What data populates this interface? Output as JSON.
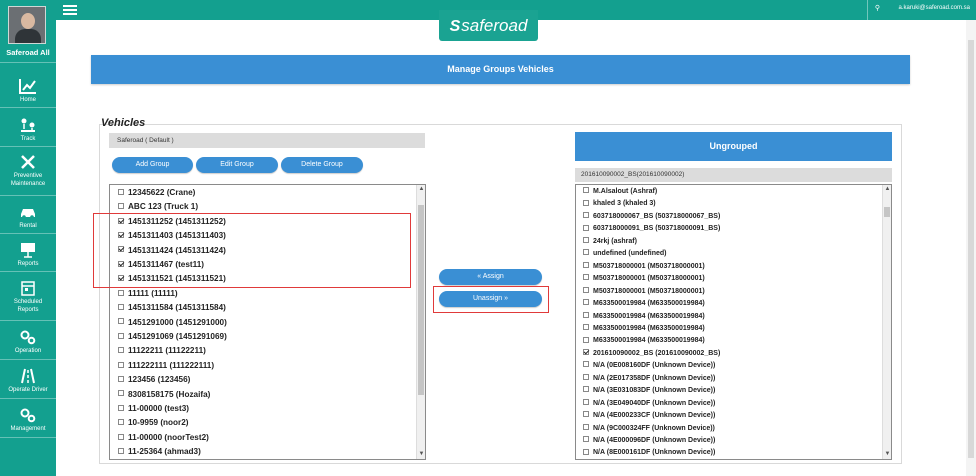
{
  "sidebar": {
    "user_label": "Saferoad All",
    "items": [
      {
        "label": "Home",
        "icon": "chart-icon"
      },
      {
        "label": "Track",
        "icon": "track-icon"
      },
      {
        "label": "Preventive Maintenance",
        "label1": "Preventive",
        "label2": "Maintenance",
        "icon": "tools-icon"
      },
      {
        "label": "Rental",
        "icon": "car-icon"
      },
      {
        "label": "Reports",
        "icon": "presentation-icon"
      },
      {
        "label": "Scheduled Reports",
        "label1": "Scheduled",
        "label2": "Reports",
        "icon": "calendar-icon"
      },
      {
        "label": "Operation",
        "icon": "gears-icon"
      },
      {
        "label": "Operate Driver",
        "icon": "road-icon"
      },
      {
        "label": "Management",
        "icon": "gears-icon"
      }
    ]
  },
  "topbar": {
    "user_email": "a.karuki@saferoad.com.sa"
  },
  "logo": {
    "text": "saferoad"
  },
  "banner": {
    "title": "Manage Groups Vehicles"
  },
  "vehicles": {
    "title": "Vehicles",
    "group_header": "Saferoad ( Default )",
    "buttons": {
      "add": "Add Group",
      "edit": "Edit Group",
      "delete": "Delete Group"
    },
    "items": [
      {
        "text": "12345622 (Crane)",
        "checked": false
      },
      {
        "text": "ABC 123 (Truck 1)",
        "checked": false
      },
      {
        "text": "1451311252 (1451311252)",
        "checked": true
      },
      {
        "text": "1451311403 (1451311403)",
        "checked": true
      },
      {
        "text": "1451311424 (1451311424)",
        "checked": true
      },
      {
        "text": "1451311467 (test11)",
        "checked": true
      },
      {
        "text": "1451311521 (1451311521)",
        "checked": true
      },
      {
        "text": "11111 (11111)",
        "checked": false
      },
      {
        "text": "1451311584 (1451311584)",
        "checked": false
      },
      {
        "text": "1451291000 (1451291000)",
        "checked": false
      },
      {
        "text": "1451291069 (1451291069)",
        "checked": false
      },
      {
        "text": "11122211 (11122211)",
        "checked": false
      },
      {
        "text": "111222111 (111222111)",
        "checked": false
      },
      {
        "text": "123456 (123456)",
        "checked": false
      },
      {
        "text": "8308158175 (Hozaifa)",
        "checked": false
      },
      {
        "text": "11-00000 (test3)",
        "checked": false
      },
      {
        "text": "10-9959 (noor2)",
        "checked": false
      },
      {
        "text": "11-00000 (noorTest2)",
        "checked": false
      },
      {
        "text": "11-25364 (ahmad3)",
        "checked": false
      }
    ]
  },
  "actions": {
    "assign": "« Assign",
    "unassign": "Unassign »"
  },
  "ungrouped": {
    "title": "Ungrouped",
    "sub_header": "201610090002_BS(201610090002)",
    "items": [
      {
        "text": "M.Alsalout (Ashraf)",
        "checked": false
      },
      {
        "text": "khaled 3 (khaled 3)",
        "checked": false
      },
      {
        "text": "603718000067_BS (503718000067_BS)",
        "checked": false
      },
      {
        "text": "603718000091_BS (503718000091_BS)",
        "checked": false
      },
      {
        "text": "24rkj (ashraf)",
        "checked": false
      },
      {
        "text": "undefined (undefined)",
        "checked": false
      },
      {
        "text": "M503718000001 (M503718000001)",
        "checked": false
      },
      {
        "text": "M503718000001 (M503718000001)",
        "checked": false
      },
      {
        "text": "M503718000001 (M503718000001)",
        "checked": false
      },
      {
        "text": "M633500019984 (M633500019984)",
        "checked": false
      },
      {
        "text": "M633500019984 (M633500019984)",
        "checked": false
      },
      {
        "text": "M633500019984 (M633500019984)",
        "checked": false
      },
      {
        "text": "M633500019984 (M633500019984)",
        "checked": false
      },
      {
        "text": "201610090002_BS (201610090002_BS)",
        "checked": true
      },
      {
        "text": "N/A (0E008160DF (Unknown Device))",
        "checked": false
      },
      {
        "text": "N/A (2E017358DF (Unknown Device))",
        "checked": false
      },
      {
        "text": "N/A (3E031083DF (Unknown Device))",
        "checked": false
      },
      {
        "text": "N/A (3E049040DF (Unknown Device))",
        "checked": false
      },
      {
        "text": "N/A (4E000233CF (Unknown Device))",
        "checked": false
      },
      {
        "text": "N/A (9C000324FF (Unknown Device))",
        "checked": false
      },
      {
        "text": "N/A (4E000096DF (Unknown Device))",
        "checked": false
      },
      {
        "text": "N/A (8E000161DF (Unknown Device))",
        "checked": false
      }
    ]
  }
}
